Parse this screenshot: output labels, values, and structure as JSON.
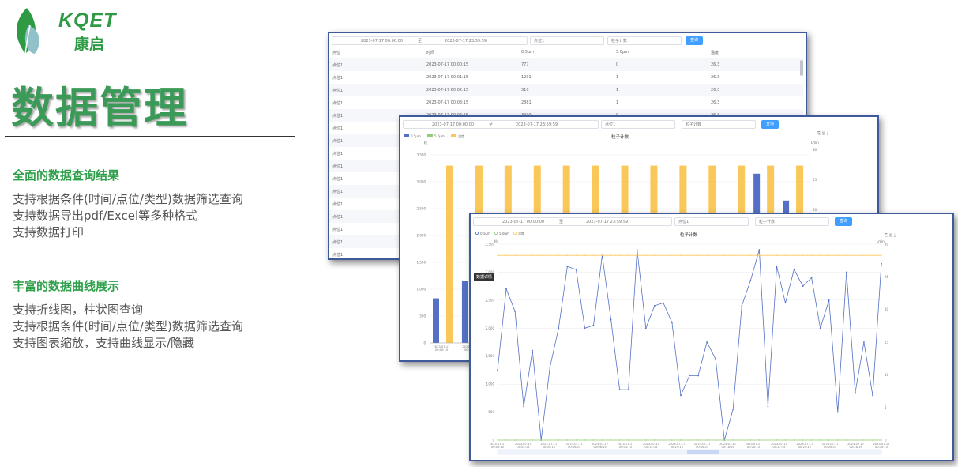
{
  "brand": {
    "logo_en": "KQET",
    "logo_cn": "康启",
    "accent": "#2e9a44"
  },
  "page_title": "数据管理",
  "sections": [
    {
      "heading": "全面的数据查询结果",
      "lines": [
        "支持根据条件(时间/点位/类型)数据筛选查询",
        "支持数据导出pdf/Excel等多种格式",
        "支持数据打印"
      ]
    },
    {
      "heading": "丰富的数据曲线展示",
      "lines": [
        "支持折线图，柱状图查询",
        "支持根据条件(时间/点位/类型)数据筛选查询",
        "支持图表缩放，支持曲线显示/隐藏"
      ]
    }
  ],
  "table_window": {
    "filters": {
      "start": "2023-07-17 00:00:00",
      "end": "2023-07-17 23:59:59",
      "point": "点位1",
      "type": "粒子计数",
      "query": "查询"
    },
    "columns": [
      "点位",
      "时间",
      "0.5μm",
      "5.0μm",
      "温度"
    ],
    "rows": [
      [
        "点位1",
        "2023-07-17 00:00:15",
        "777",
        "0",
        "26.3"
      ],
      [
        "点位1",
        "2023-07-17 00:01:15",
        "1201",
        "1",
        "26.3"
      ],
      [
        "点位1",
        "2023-07-17 00:02:15",
        "310",
        "1",
        "26.3"
      ],
      [
        "点位1",
        "2023-07-17 00:03:15",
        "2881",
        "1",
        "26.3"
      ],
      [
        "点位1",
        "2023-07-17 00:04:15",
        "3400",
        "0",
        "26.3"
      ],
      [
        "点位1"
      ],
      [
        "点位1"
      ],
      [
        "点位1"
      ],
      [
        "点位1"
      ],
      [
        "点位1"
      ],
      [
        "点位1"
      ],
      [
        "点位1"
      ],
      [
        "点位1"
      ],
      [
        "点位1"
      ],
      [
        "点位1"
      ],
      [
        "点位1"
      ]
    ]
  },
  "bar_window": {
    "filters": {
      "start": "2023-07-17 00:00:00",
      "end": "2023-07-17 23:59:59",
      "point": "点位1",
      "type": "粒子计数",
      "query": "查询"
    },
    "legend": [
      "0.5μm",
      "5.0μm",
      "温度"
    ]
  },
  "line_window": {
    "filters": {
      "start": "2023-07-17 00:00:00",
      "end": "2023-07-17 23:59:59",
      "point": "点位1",
      "type": "粒子计数",
      "query": "查询"
    },
    "tooltip": "数据详情",
    "legend": [
      "0.5μm",
      "5.0μm",
      "温度"
    ]
  },
  "colors": {
    "blue": "#5470c6",
    "green": "#91cc75",
    "yellow": "#fac858"
  },
  "chart_data": [
    {
      "type": "bar",
      "title": "粒子计数",
      "ylabel": "粒",
      "y2label": "Lmin",
      "ylim": [
        0,
        3500
      ],
      "y2lim": [
        0,
        30
      ],
      "yticks": [
        "0",
        "500",
        "1,000",
        "1,500",
        "2,000",
        "2,500",
        "3,000",
        "3,500"
      ],
      "y2ticks": [
        "30",
        "25",
        "20"
      ],
      "categories": [
        "2023-07-17 00:00:15",
        "2023-07-17 00:01:15",
        "",
        "",
        "",
        "",
        "",
        "",
        "",
        "",
        "",
        "",
        ""
      ],
      "series": [
        {
          "name": "0.5μm",
          "values": [
            830,
            1150,
            0,
            0,
            0,
            0,
            0,
            180,
            0,
            850,
            1250,
            0,
            0
          ]
        },
        {
          "name": "5.0μm",
          "values": [
            0,
            0,
            0,
            0,
            0,
            0,
            0,
            0,
            0,
            0,
            0,
            0,
            0
          ]
        },
        {
          "name": "温度",
          "values": [
            3300,
            3300,
            3300,
            3300,
            3300,
            3300,
            3300,
            3300,
            3300,
            3300,
            3300,
            3300,
            3300
          ]
        }
      ],
      "extra_blue": [
        0,
        0,
        0,
        0,
        0,
        0,
        0,
        0,
        0,
        0,
        3380,
        3150,
        2650
      ]
    },
    {
      "type": "line",
      "title": "粒子计数",
      "ylabel": "粒",
      "y2label": "Lmin",
      "ylim": [
        0,
        3500
      ],
      "y2lim": [
        0,
        30
      ],
      "yticks": [
        "0",
        "500",
        "1,000",
        "1,500",
        "2,000",
        "2,500",
        "3,000",
        "3,500"
      ],
      "y2ticks": [
        "0",
        "5",
        "10",
        "15",
        "20",
        "25",
        "30"
      ],
      "xlabels": [
        "2023-07-17\n00:00:15",
        "2023-07-17\n00:02:15",
        "2023-07-17\n00:04:15",
        "2023-07-17\n00:06:15",
        "2023-07-17\n00:08:15",
        "2023-07-17\n00:10:15",
        "2023-07-17\n00:12:15",
        "2023-07-17\n00:14:15",
        "2023-07-17\n00:16:15",
        "2023-07-17\n00:18:15",
        "2023-07-17\n00:20:15",
        "2023-07-17\n00:22:15",
        "2023-07-17\n00:24:15",
        "2023-07-17\n00:26:15",
        "2023-07-17\n00:28:15",
        "2023-07-17\n00:30:15"
      ],
      "series": [
        {
          "name": "0.5μm",
          "values": [
            1250,
            2700,
            2300,
            600,
            1600,
            0,
            1300,
            2000,
            3100,
            3050,
            2000,
            2050,
            3300,
            2150,
            900,
            900,
            3400,
            2000,
            2400,
            2450,
            2100,
            800,
            1150,
            1150,
            1750,
            1450,
            0,
            550,
            2400,
            2850,
            3400,
            600,
            3100,
            2450,
            3050,
            2750,
            2900,
            2000,
            2500,
            500,
            3000,
            850,
            1750,
            800,
            3150
          ]
        },
        {
          "name": "5.0μm",
          "values": [
            0,
            0,
            0,
            0,
            0,
            0,
            0,
            0,
            0,
            0,
            0,
            0,
            0,
            0,
            0,
            0,
            0,
            0,
            0,
            0,
            0,
            0,
            0,
            0,
            0,
            0,
            0,
            0,
            0,
            0,
            0,
            0,
            0,
            0,
            0,
            0,
            0,
            0,
            0,
            0,
            0,
            0,
            0,
            0,
            0
          ]
        },
        {
          "name": "温度",
          "values": [
            3300,
            3300,
            3300,
            3300,
            3300,
            3300,
            3300,
            3300,
            3300,
            3300,
            3300,
            3300,
            3300,
            3300,
            3300,
            3300,
            3300,
            3300,
            3300,
            3300,
            3300,
            3300,
            3300,
            3300,
            3300,
            3300,
            3300,
            3300,
            3300,
            3300,
            3300,
            3300,
            3300,
            3300,
            3300,
            3300,
            3300,
            3300,
            3300,
            3300,
            3300,
            3300,
            3300,
            3300,
            3300
          ]
        }
      ]
    }
  ]
}
